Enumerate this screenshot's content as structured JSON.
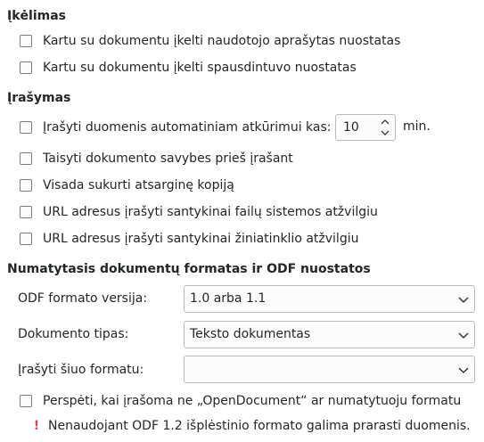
{
  "loading": {
    "title": "Įkėlimas",
    "user_settings_label": "Kartu su dokumentu įkelti naudotojo aprašytas nuostatas",
    "printer_settings_label": "Kartu su dokumentu įkelti spausdintuvo nuostatas"
  },
  "saving": {
    "title": "Įrašymas",
    "autosave_label": "Įrašyti duomenis automatiniam atkūrimui kas:",
    "autosave_value": "10",
    "autosave_unit": "min.",
    "edit_props_label": "Taisyti dokumento savybes prieš įrašant",
    "backup_label": "Visada sukurti atsarginę kopiją",
    "url_fs_label": "URL adresus įrašyti santykinai failų sistemos atžvilgiu",
    "url_web_label": "URL adresus įrašyti santykinai žiniatinklio atžvilgiu"
  },
  "defaults": {
    "title": "Numatytasis dokumentų formatas ir ODF nuostatos",
    "odf_version_label": "ODF formato versija:",
    "odf_version_value": "1.0 arba 1.1",
    "doc_type_label": "Dokumento tipas:",
    "doc_type_value": "Teksto dokumentas",
    "save_as_label": "Įrašyti šiuo formatu:",
    "save_as_value": "",
    "warn_label": "Perspėti, kai įrašoma ne „OpenDocument“ ar numatytuoju formatu",
    "warning_text": "Nenaudojant ODF 1.2 išplėstinio formato galima prarasti duomenis."
  }
}
